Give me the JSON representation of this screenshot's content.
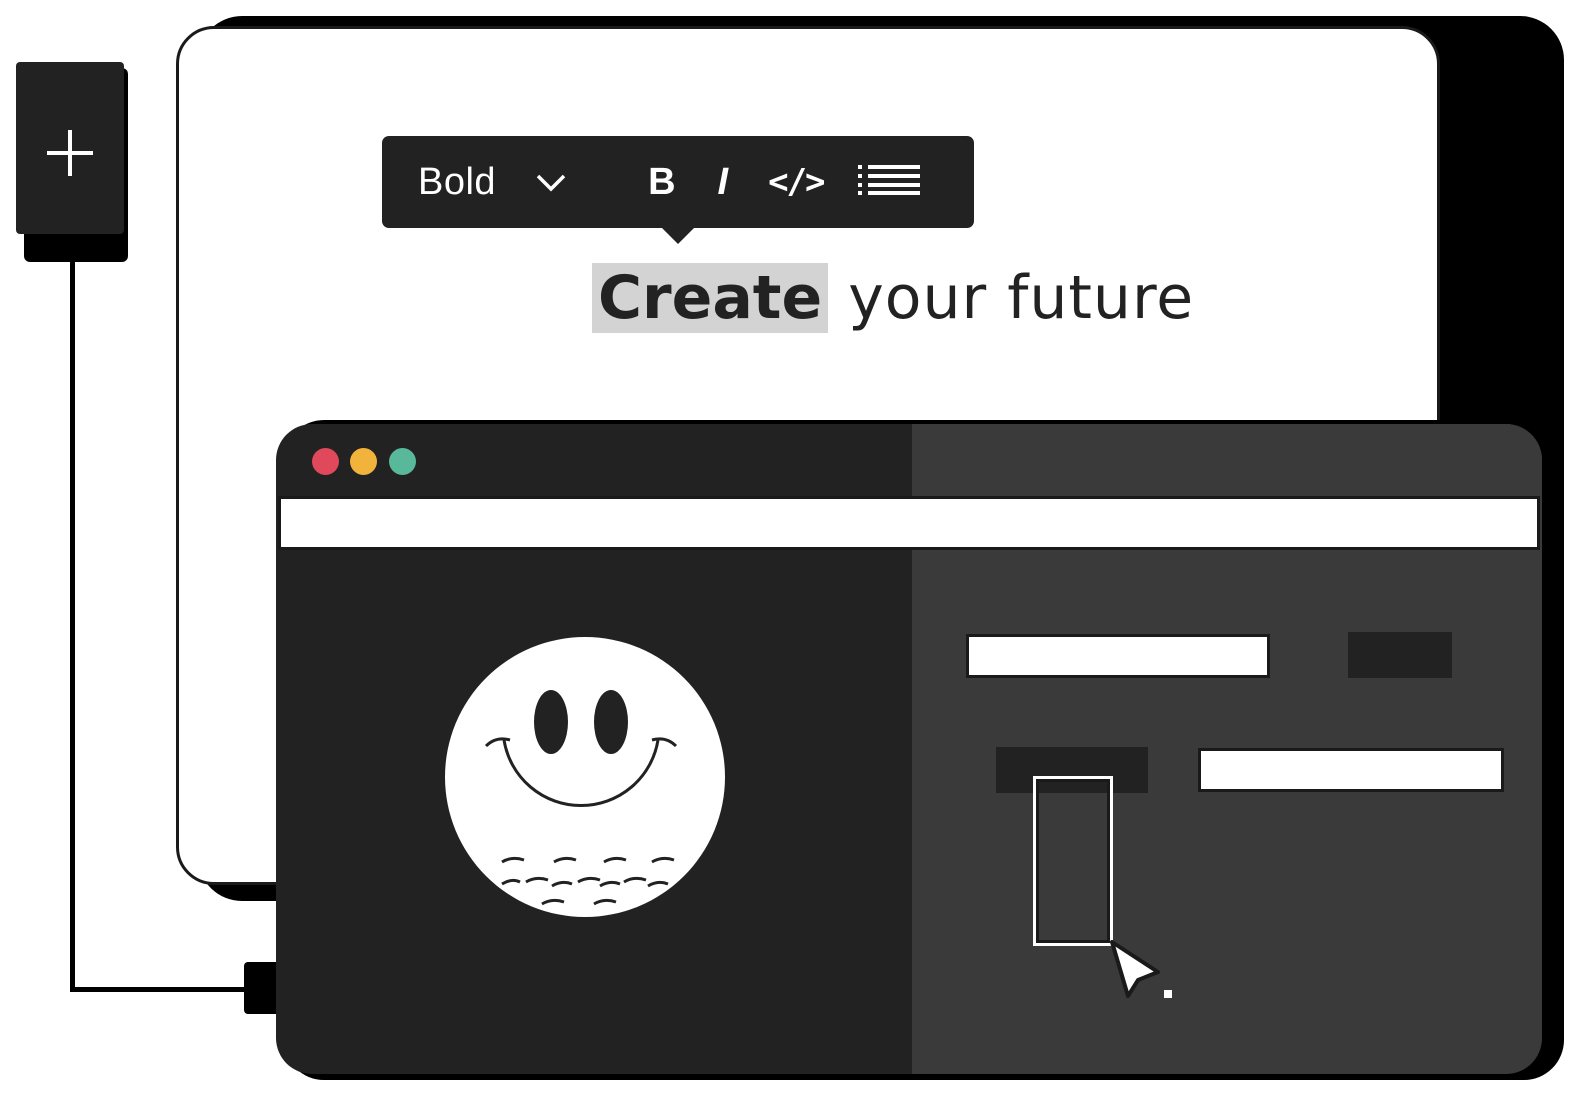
{
  "add_block": {
    "icon": "plus-icon"
  },
  "toolbar": {
    "style_select": {
      "selected": "Bold",
      "icon": "chevron-down-icon"
    },
    "buttons": [
      {
        "name": "bold",
        "label": "B"
      },
      {
        "name": "italic",
        "label": "I"
      },
      {
        "name": "code",
        "label": "</>"
      },
      {
        "name": "list",
        "icon": "list-icon"
      }
    ]
  },
  "headline": {
    "selected": "Create",
    "rest": " your future"
  },
  "browser": {
    "window_controls": [
      {
        "name": "close",
        "color": "#e0485c"
      },
      {
        "name": "minimize",
        "color": "#f2b33d"
      },
      {
        "name": "maximize",
        "color": "#59b89a"
      }
    ],
    "illustration": "smiley-face-icon",
    "pointer": "arrow-cursor-icon"
  },
  "colors": {
    "dark": "#222222",
    "dark_panel": "#3a3a3a",
    "selection": "#d3d3d3",
    "paper": "#ffffff"
  }
}
